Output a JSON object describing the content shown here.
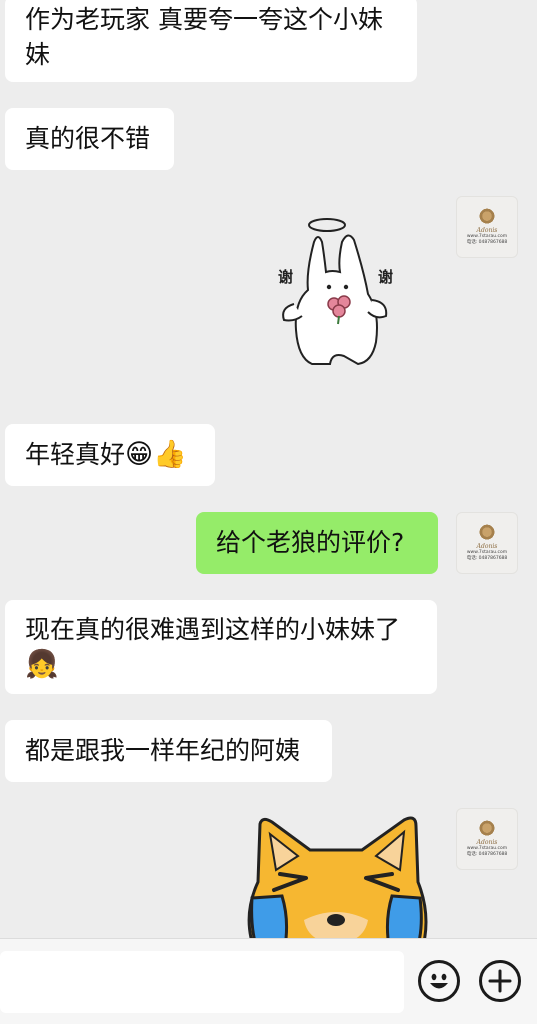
{
  "messages": {
    "m1": "作为老玩家 真要夸一夸这个小妹妹",
    "m1_line1": "作为老玩家 真要夸一夸这个小妹",
    "m1_line2": "妹",
    "m2": "真的很不错",
    "m3": "年轻真好",
    "m3_emoji1": "😁",
    "m3_emoji2": "👍",
    "m4": "给个老狼的评价?",
    "m5_line1": "现在真的很难遇到这样的小妹妹了",
    "m5_emoji": "👧",
    "m6": "都是跟我一样年纪的阿姨"
  },
  "stickers": {
    "bunny_left_text": "谢",
    "bunny_right_text": "谢",
    "bunny_icon": "angel-bunny-thanks-sticker",
    "dog_icon": "crying-shiba-sticker"
  },
  "avatar": {
    "script": "Adonis",
    "line1": "www.7starau.com",
    "line2": "电话: 0487867688"
  },
  "input": {
    "value": "",
    "placeholder": ""
  },
  "icons": {
    "emoji_button": "smiley-face-icon",
    "plus_button": "plus-circle-icon"
  },
  "colors": {
    "background": "#ededed",
    "incoming_bubble": "#ffffff",
    "outgoing_bubble": "#95ec69"
  }
}
